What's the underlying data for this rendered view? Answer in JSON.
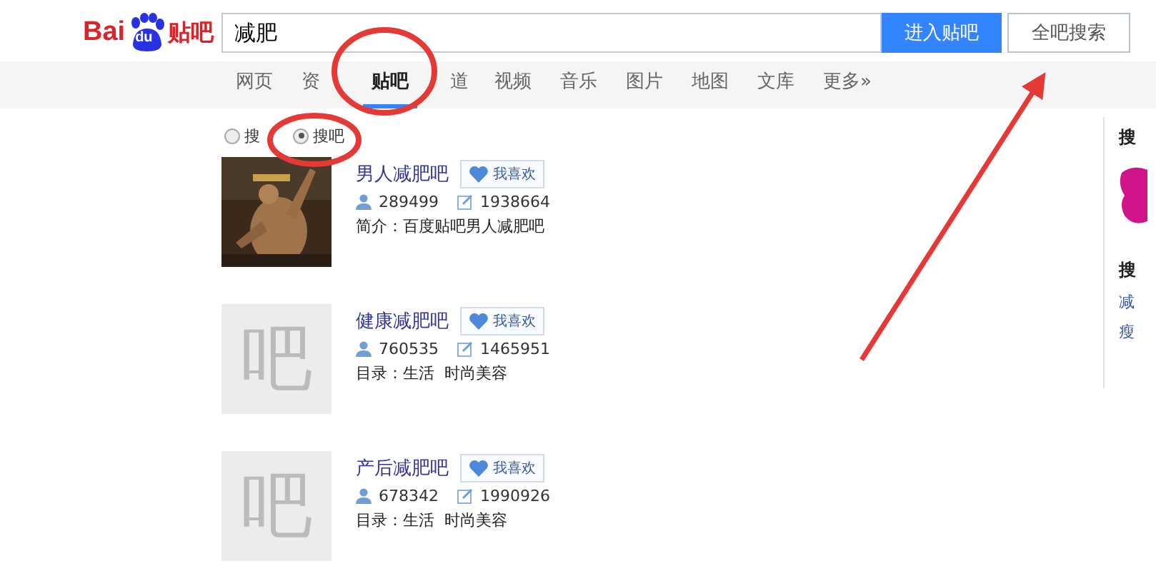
{
  "logo": {
    "latin": "Bai",
    "paw_text": "du",
    "chinese": "贴吧"
  },
  "search": {
    "value": "减肥",
    "submit_button": "进入贴吧",
    "global_button": "全吧搜索"
  },
  "nav_tabs": [
    {
      "label": "网页",
      "selected": false
    },
    {
      "label": "资",
      "selected": false
    },
    {
      "label": "贴吧",
      "selected": true
    },
    {
      "label": "道",
      "selected": false
    },
    {
      "label": "视频",
      "selected": false
    },
    {
      "label": "音乐",
      "selected": false
    },
    {
      "label": "图片",
      "selected": false
    },
    {
      "label": "地图",
      "selected": false
    },
    {
      "label": "文库",
      "selected": false
    },
    {
      "label": "更多»",
      "selected": false
    }
  ],
  "search_modes": [
    {
      "label": "搜",
      "selected": false
    },
    {
      "label": "搜吧",
      "selected": true
    }
  ],
  "results": [
    {
      "kind": "picture",
      "name": "男人减肥吧",
      "like_button": "我喜欢",
      "members": "289499",
      "posts": "1938664",
      "description": "简介：百度贴吧男人减肥吧"
    },
    {
      "kind": "placeholder",
      "placeholder_glyph": "吧",
      "name": "健康减肥吧",
      "like_button": "我喜欢",
      "members": "760535",
      "posts": "1465951",
      "description": "目录：生活  时尚美容"
    },
    {
      "kind": "placeholder",
      "placeholder_glyph": "吧",
      "name": "产后减肥吧",
      "like_button": "我喜欢",
      "members": "678342",
      "posts": "1990926",
      "description": "目录：生活  时尚美容"
    }
  ],
  "sidebar": {
    "heading": "搜",
    "section_heading": "搜",
    "links": [
      "减",
      "瘦"
    ]
  }
}
